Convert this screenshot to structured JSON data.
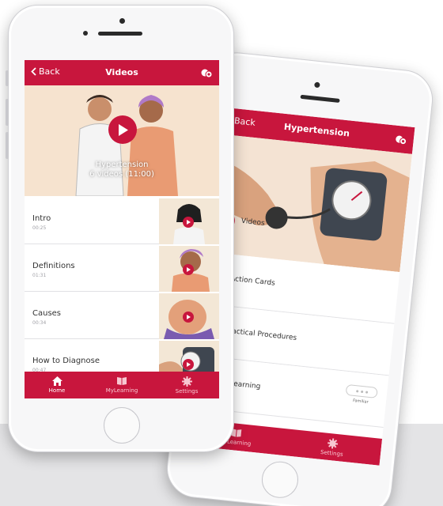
{
  "brand": {
    "accent": "#c8163d",
    "floor": "#e4e4e6"
  },
  "phone1": {
    "nav": {
      "back_label": "Back",
      "title": "Videos",
      "right_icon": "chat-bubbles-icon"
    },
    "hero": {
      "title": "Hypertension",
      "subtitle": "6 videos (11:00)"
    },
    "videos": [
      {
        "title": "Intro",
        "duration": "00:25"
      },
      {
        "title": "Definitions",
        "duration": "01:31"
      },
      {
        "title": "Causes",
        "duration": "00:34"
      },
      {
        "title": "How to Diagnose",
        "duration": "00:47"
      }
    ],
    "tabs": [
      {
        "label": "Home",
        "icon": "home-icon",
        "active": true
      },
      {
        "label": "MyLearning",
        "icon": "book-icon",
        "active": false
      },
      {
        "label": "Settings",
        "icon": "gear-icon",
        "active": false
      }
    ]
  },
  "phone2": {
    "nav": {
      "back_label": "Back",
      "title": "Hypertension",
      "right_icon": "chat-bubbles-icon"
    },
    "hero_label": "Videos",
    "menu": [
      {
        "label": "Action Cards",
        "icon": "cards-icon"
      },
      {
        "label": "Practical Procedures",
        "icon": "procedures-icon"
      },
      {
        "label": "MyLearning",
        "icon": "learning-icon",
        "badge": "Familiar"
      }
    ],
    "tabs": [
      {
        "label": "MyLearning",
        "icon": "book-icon"
      },
      {
        "label": "Settings",
        "icon": "gear-icon"
      }
    ]
  }
}
